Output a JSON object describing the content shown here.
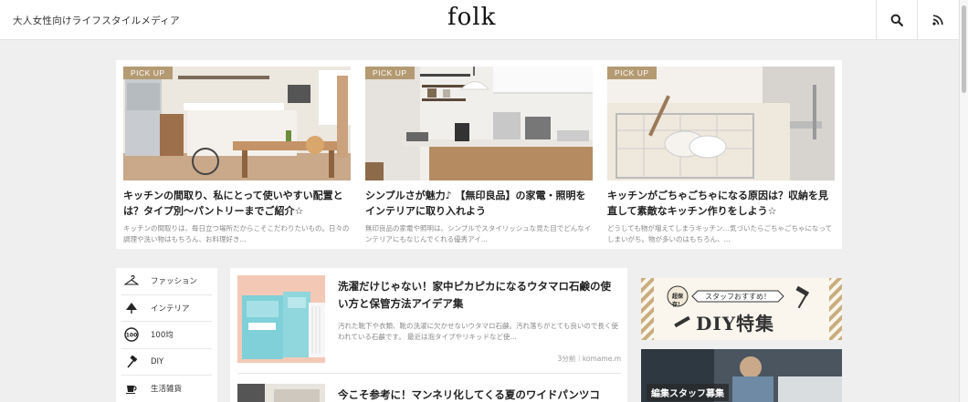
{
  "header": {
    "tagline": "大人女性向けライフスタイルメディア",
    "logo": "folk",
    "icons": [
      "search-icon",
      "rss-icon"
    ]
  },
  "pickup": {
    "badge": "PICK UP",
    "cards": [
      {
        "title": "キッチンの間取り、私にとって使いやすい配置とは？タイプ別〜パントリーまでご紹介☆",
        "excerpt": "キッチンの間取りは、毎日立つ場所だからこそこだわりたいもの。日々の調理や洗い物はもちろん、お料理好き..."
      },
      {
        "title": "シンプルさが魅力♪ 【無印良品】の家電・照明をインテリアに取り入れよう",
        "excerpt": "無印良品の家電や照明は、シンプルでスタイリッシュな見た目でどんなインテリアにもなじんでくれる優秀アイ..."
      },
      {
        "title": "キッチンがごちゃごちゃになる原因は？収納を見直して素敵なキッチン作りをしよう☆",
        "excerpt": "どうしても物が増えてしまうキッチン…気づいたらごちゃごちゃになってしまいがち。物が多いのはもちろん、..."
      }
    ]
  },
  "sidebar": {
    "categories": [
      {
        "label": "ファッション",
        "icon": "hanger-icon"
      },
      {
        "label": "インテリア",
        "icon": "lamp-icon"
      },
      {
        "label": "100均",
        "icon": "100-yen-icon"
      },
      {
        "label": "DIY",
        "icon": "hammer-icon"
      },
      {
        "label": "生活雑貨",
        "icon": "cup-icon"
      }
    ]
  },
  "articles": [
    {
      "title": "洗濯だけじゃない！家中ピカピカになるウタマロ石鹸の使い方と保管方法アイデア集",
      "excerpt": "汚れた靴下や衣類、靴の洗濯に欠かせないウタマロ石鹸。汚れ落ちがとても良いので長く使われている石鹸です。 最近は泡タイプやリキッドなど使...",
      "meta": "3分前｜komame.m"
    },
    {
      "title": "今こそ参考に！マンネリ化してくる夏のワイドパンツコ",
      "excerpt": "",
      "meta": ""
    }
  ],
  "banners": {
    "diy": {
      "title": "DIY特集",
      "subtitle": "スタッフおすすめ！",
      "stamp": "超保存！"
    },
    "staff": {
      "label": "編集スタッフ募集"
    }
  },
  "colors": {
    "badge": "#b49a73",
    "background": "#efefef",
    "card": "#ffffff"
  }
}
